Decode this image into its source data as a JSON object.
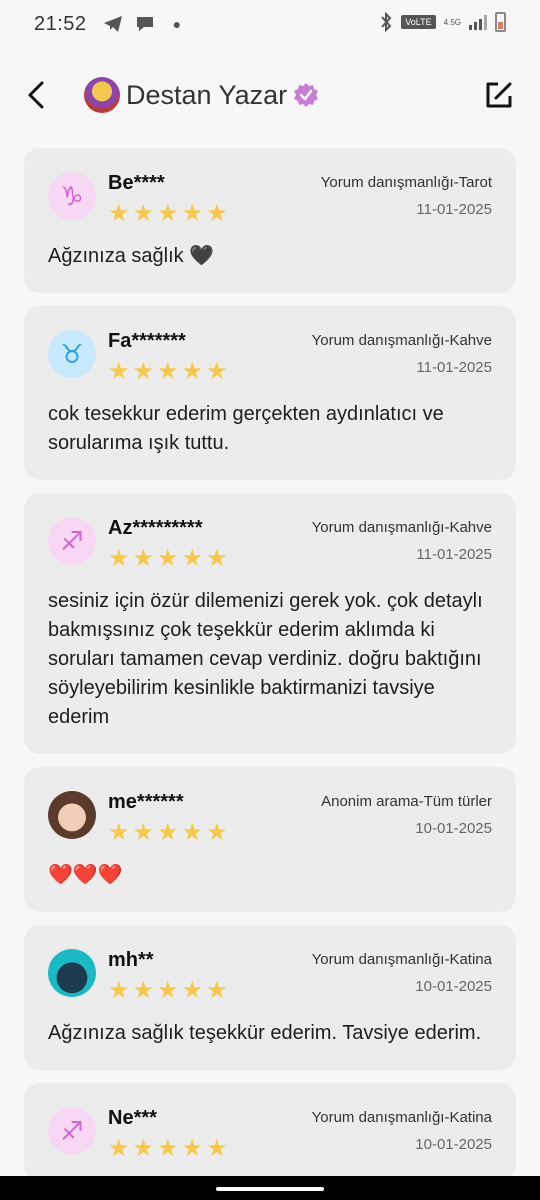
{
  "status_bar": {
    "time": "21:52",
    "icons": [
      "telegram-icon",
      "chat-bubble-icon",
      "dot-icon",
      "bluetooth-icon",
      "volte-icon",
      "signal-icon",
      "battery-icon"
    ],
    "volte": "VoLTE",
    "net": "4.5G"
  },
  "header": {
    "name": "Destan Yazar",
    "verified": true
  },
  "reviews": [
    {
      "name": "Be****",
      "service": "Yorum danışmanlığı-Tarot",
      "date": "11-01-2025",
      "rating": 5,
      "avatar": "capricorn-icon",
      "text": "Ağzınıza sağlık 🖤"
    },
    {
      "name": "Fa*******",
      "service": "Yorum danışmanlığı-Kahve",
      "date": "11-01-2025",
      "rating": 5,
      "avatar": "taurus-icon",
      "text": "cok tesekkur ederim gerçekten aydınlatıcı ve sorularıma ışık tuttu."
    },
    {
      "name": "Az*********",
      "service": "Yorum danışmanlığı-Kahve",
      "date": "11-01-2025",
      "rating": 5,
      "avatar": "sagittarius-icon",
      "text": "sesiniz için özür dilemenizi gerek yok. çok detaylı bakmışsınız çok teşekkür ederim aklımda ki soruları tamamen cevap verdiniz. doğru baktığını söyleyebilirim kesinlikle baktirmanizi tavsiye ederim"
    },
    {
      "name": "me******",
      "service": "Anonim arama-Tüm türler",
      "date": "10-01-2025",
      "rating": 5,
      "avatar": "baby-photo",
      "text": "❤️❤️❤️"
    },
    {
      "name": "mh**",
      "service": "Yorum danışmanlığı-Katina",
      "date": "10-01-2025",
      "rating": 5,
      "avatar": "anime-photo",
      "text": "Ağzınıza sağlık teşekkür ederim. Tavsiye ederim."
    },
    {
      "name": "Ne***",
      "service": "Yorum danışmanlığı-Katina",
      "date": "10-01-2025",
      "rating": 5,
      "avatar": "sagittarius-icon",
      "text": ""
    }
  ],
  "colors": {
    "star": "#f6c94c",
    "card": "#ececec",
    "verified": "#c77dd8"
  }
}
